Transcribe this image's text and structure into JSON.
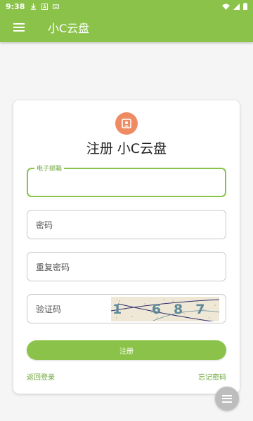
{
  "status_bar": {
    "time": "9:38",
    "icons": [
      "download-icon",
      "notification-a-icon",
      "keyboard-icon",
      "wifi-icon",
      "signal-icon",
      "battery-icon"
    ]
  },
  "app_bar": {
    "title": "小C云盘",
    "menu_icon": "hamburger-menu-icon"
  },
  "form": {
    "avatar_icon": "contact-card-icon",
    "title": "注册 小C云盘",
    "email_label": "电子邮箱",
    "email_value": "",
    "password_placeholder": "密码",
    "confirm_password_placeholder": "重复密码",
    "captcha_placeholder": "验证码",
    "captcha_text": "1 687",
    "submit_label": "注册",
    "back_to_login": "返回登录",
    "forgot_password": "忘记密码"
  },
  "fab_icon": "menu-icon",
  "colors": {
    "primary": "#8bc34a",
    "accent_text": "#6ea73a",
    "avatar_bg": "#ef8b62",
    "fab_bg": "#bdbdbd"
  }
}
